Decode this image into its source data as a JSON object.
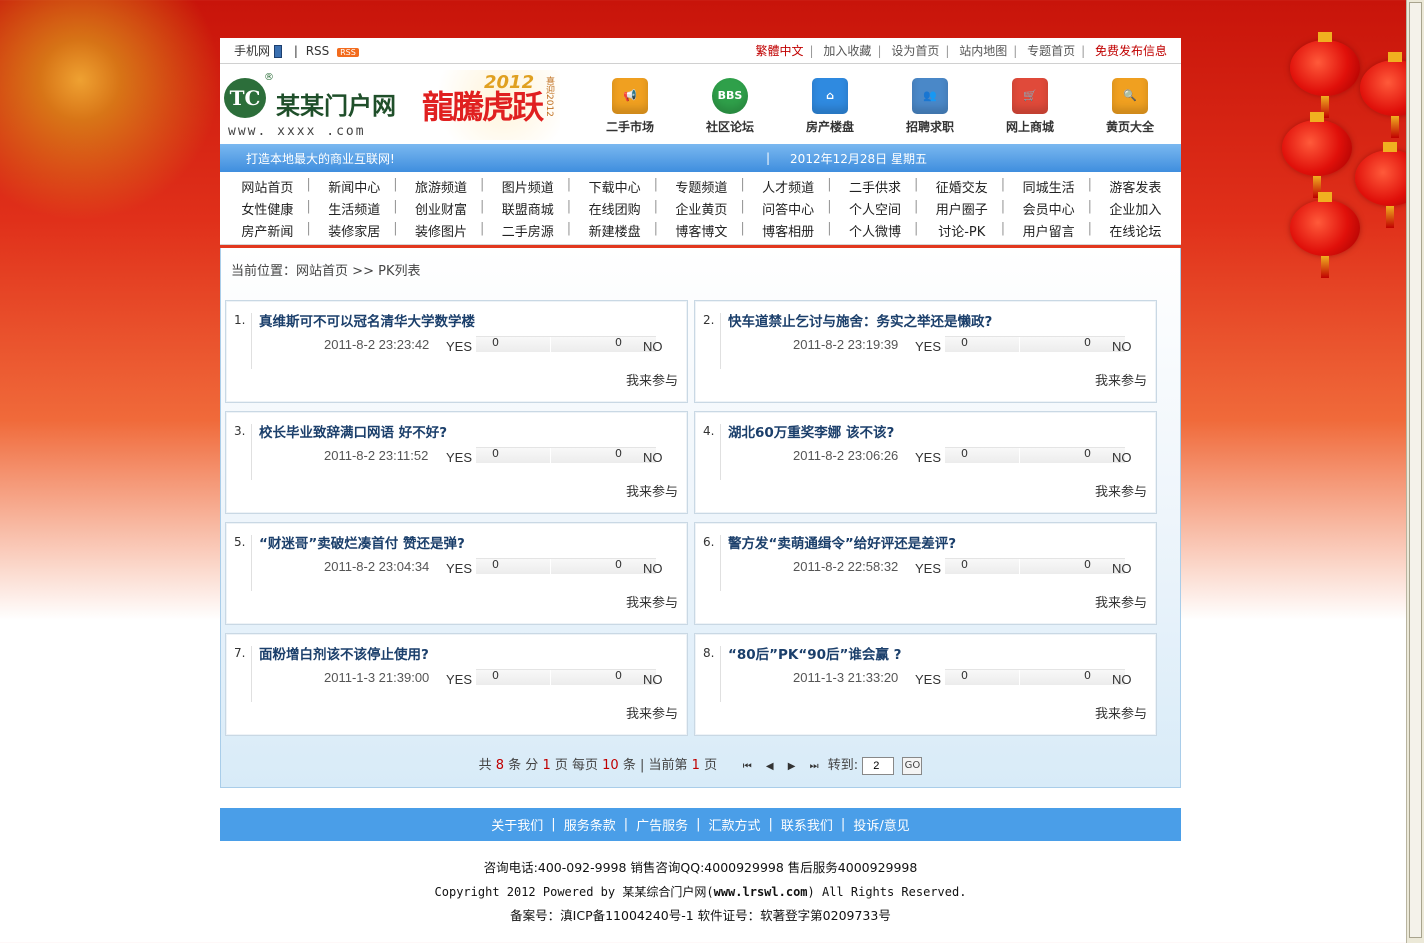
{
  "topbar": {
    "mobile": "手机网",
    "rss": "RSS",
    "rss_badge": "RSS",
    "links": [
      "繁體中文",
      "加入收藏",
      "设为首页",
      "站内地图",
      "专题首页",
      "免费发布信息"
    ]
  },
  "logo": {
    "mark": "TC",
    "reg": "®",
    "name": "某某门户网",
    "url": "www. xxxx .com"
  },
  "banner": {
    "main": "龍騰虎跃",
    "year": "2012",
    "side": "喜迎2012"
  },
  "navicons": [
    {
      "label": "二手市场",
      "icon": "megaphone-icon",
      "color": "#f0a020"
    },
    {
      "label": "社区论坛",
      "icon": "bbs-icon",
      "color": "#2fa04a"
    },
    {
      "label": "房产楼盘",
      "icon": "house-icon",
      "color": "#2f8ae0"
    },
    {
      "label": "招聘求职",
      "icon": "people-icon",
      "color": "#4a88c8"
    },
    {
      "label": "网上商城",
      "icon": "cart-icon",
      "color": "#e04a3a"
    },
    {
      "label": "黄页大全",
      "icon": "magnifier-icon",
      "color": "#f0a020"
    }
  ],
  "infobar": {
    "slogan": "打造本地最大的商业互联网!",
    "sep": "|",
    "date": "2012年12月28日 星期五"
  },
  "menu": [
    [
      "网站首页",
      "新闻中心",
      "旅游频道",
      "图片频道",
      "下载中心",
      "专题频道",
      "人才频道",
      "二手供求",
      "征婚交友",
      "同城生活",
      "游客发表"
    ],
    [
      "女性健康",
      "生活频道",
      "创业财富",
      "联盟商城",
      "在线团购",
      "企业黄页",
      "问答中心",
      "个人空间",
      "用户圈子",
      "会员中心",
      "企业加入"
    ],
    [
      "房产新闻",
      "装修家居",
      "装修图片",
      "二手房源",
      "新建楼盘",
      "博客博文",
      "博客相册",
      "个人微博",
      "讨论-PK",
      "用户留言",
      "在线论坛"
    ]
  ],
  "breadcrumb": {
    "prefix": "当前位置：",
    "home": "网站首页",
    "sep": ">>",
    "current": "PK列表"
  },
  "pk_items": [
    {
      "num": "1.",
      "title": "真维斯可不可以冠名清华大学数学楼",
      "date": "2011-8-2 23:23:42",
      "yes_label": "YES",
      "yes": "0",
      "no": "0",
      "no_label": "NO",
      "join": "我来参与"
    },
    {
      "num": "2.",
      "title": "快车道禁止乞讨与施舍：务实之举还是懒政?",
      "date": "2011-8-2 23:19:39",
      "yes_label": "YES",
      "yes": "0",
      "no": "0",
      "no_label": "NO",
      "join": "我来参与"
    },
    {
      "num": "3.",
      "title": "校长毕业致辞满口网语 好不好?",
      "date": "2011-8-2 23:11:52",
      "yes_label": "YES",
      "yes": "0",
      "no": "0",
      "no_label": "NO",
      "join": "我来参与"
    },
    {
      "num": "4.",
      "title": "湖北60万重奖李娜 该不该?",
      "date": "2011-8-2 23:06:26",
      "yes_label": "YES",
      "yes": "0",
      "no": "0",
      "no_label": "NO",
      "join": "我来参与"
    },
    {
      "num": "5.",
      "title": "“财迷哥”卖破烂凑首付 赞还是弹?",
      "date": "2011-8-2 23:04:34",
      "yes_label": "YES",
      "yes": "0",
      "no": "0",
      "no_label": "NO",
      "join": "我来参与"
    },
    {
      "num": "6.",
      "title": "警方发“卖萌通缉令”给好评还是差评?",
      "date": "2011-8-2 22:58:32",
      "yes_label": "YES",
      "yes": "0",
      "no": "0",
      "no_label": "NO",
      "join": "我来参与"
    },
    {
      "num": "7.",
      "title": "面粉增白剂该不该停止使用?",
      "date": "2011-1-3 21:39:00",
      "yes_label": "YES",
      "yes": "0",
      "no": "0",
      "no_label": "NO",
      "join": "我来参与"
    },
    {
      "num": "8.",
      "title": "“80后”PK“90后”谁会赢 ?",
      "date": "2011-1-3 21:33:20",
      "yes_label": "YES",
      "yes": "0",
      "no": "0",
      "no_label": "NO",
      "join": "我来参与"
    }
  ],
  "pager": {
    "t1": "共",
    "total": "8",
    "t2": "条 分",
    "pages": "1",
    "t3": "页 每页",
    "per": "10",
    "t4": "条 | 当前第",
    "current": "1",
    "t5": "页",
    "first": "⏮",
    "prev": "◀",
    "next": "▶",
    "last": "⏭",
    "goto_label": "转到:",
    "goto_value": "2",
    "go": "GO"
  },
  "footer": {
    "links": [
      "关于我们",
      "服务条款",
      "广告服务",
      "汇款方式",
      "联系我们",
      "投诉/意见"
    ],
    "phone": "咨询电话:400-092-9998 销售咨询QQ:4000929998 售后服务4000929998",
    "copy_pre": "Copyright 2012 Powered by 某某综合门户网(",
    "copy_site": "www.lrswl.com",
    "copy_post": ") All Rights Reserved.",
    "icp": "备案号：滇ICP备11004240号-1 软件证号：软著登字第0209733号"
  }
}
